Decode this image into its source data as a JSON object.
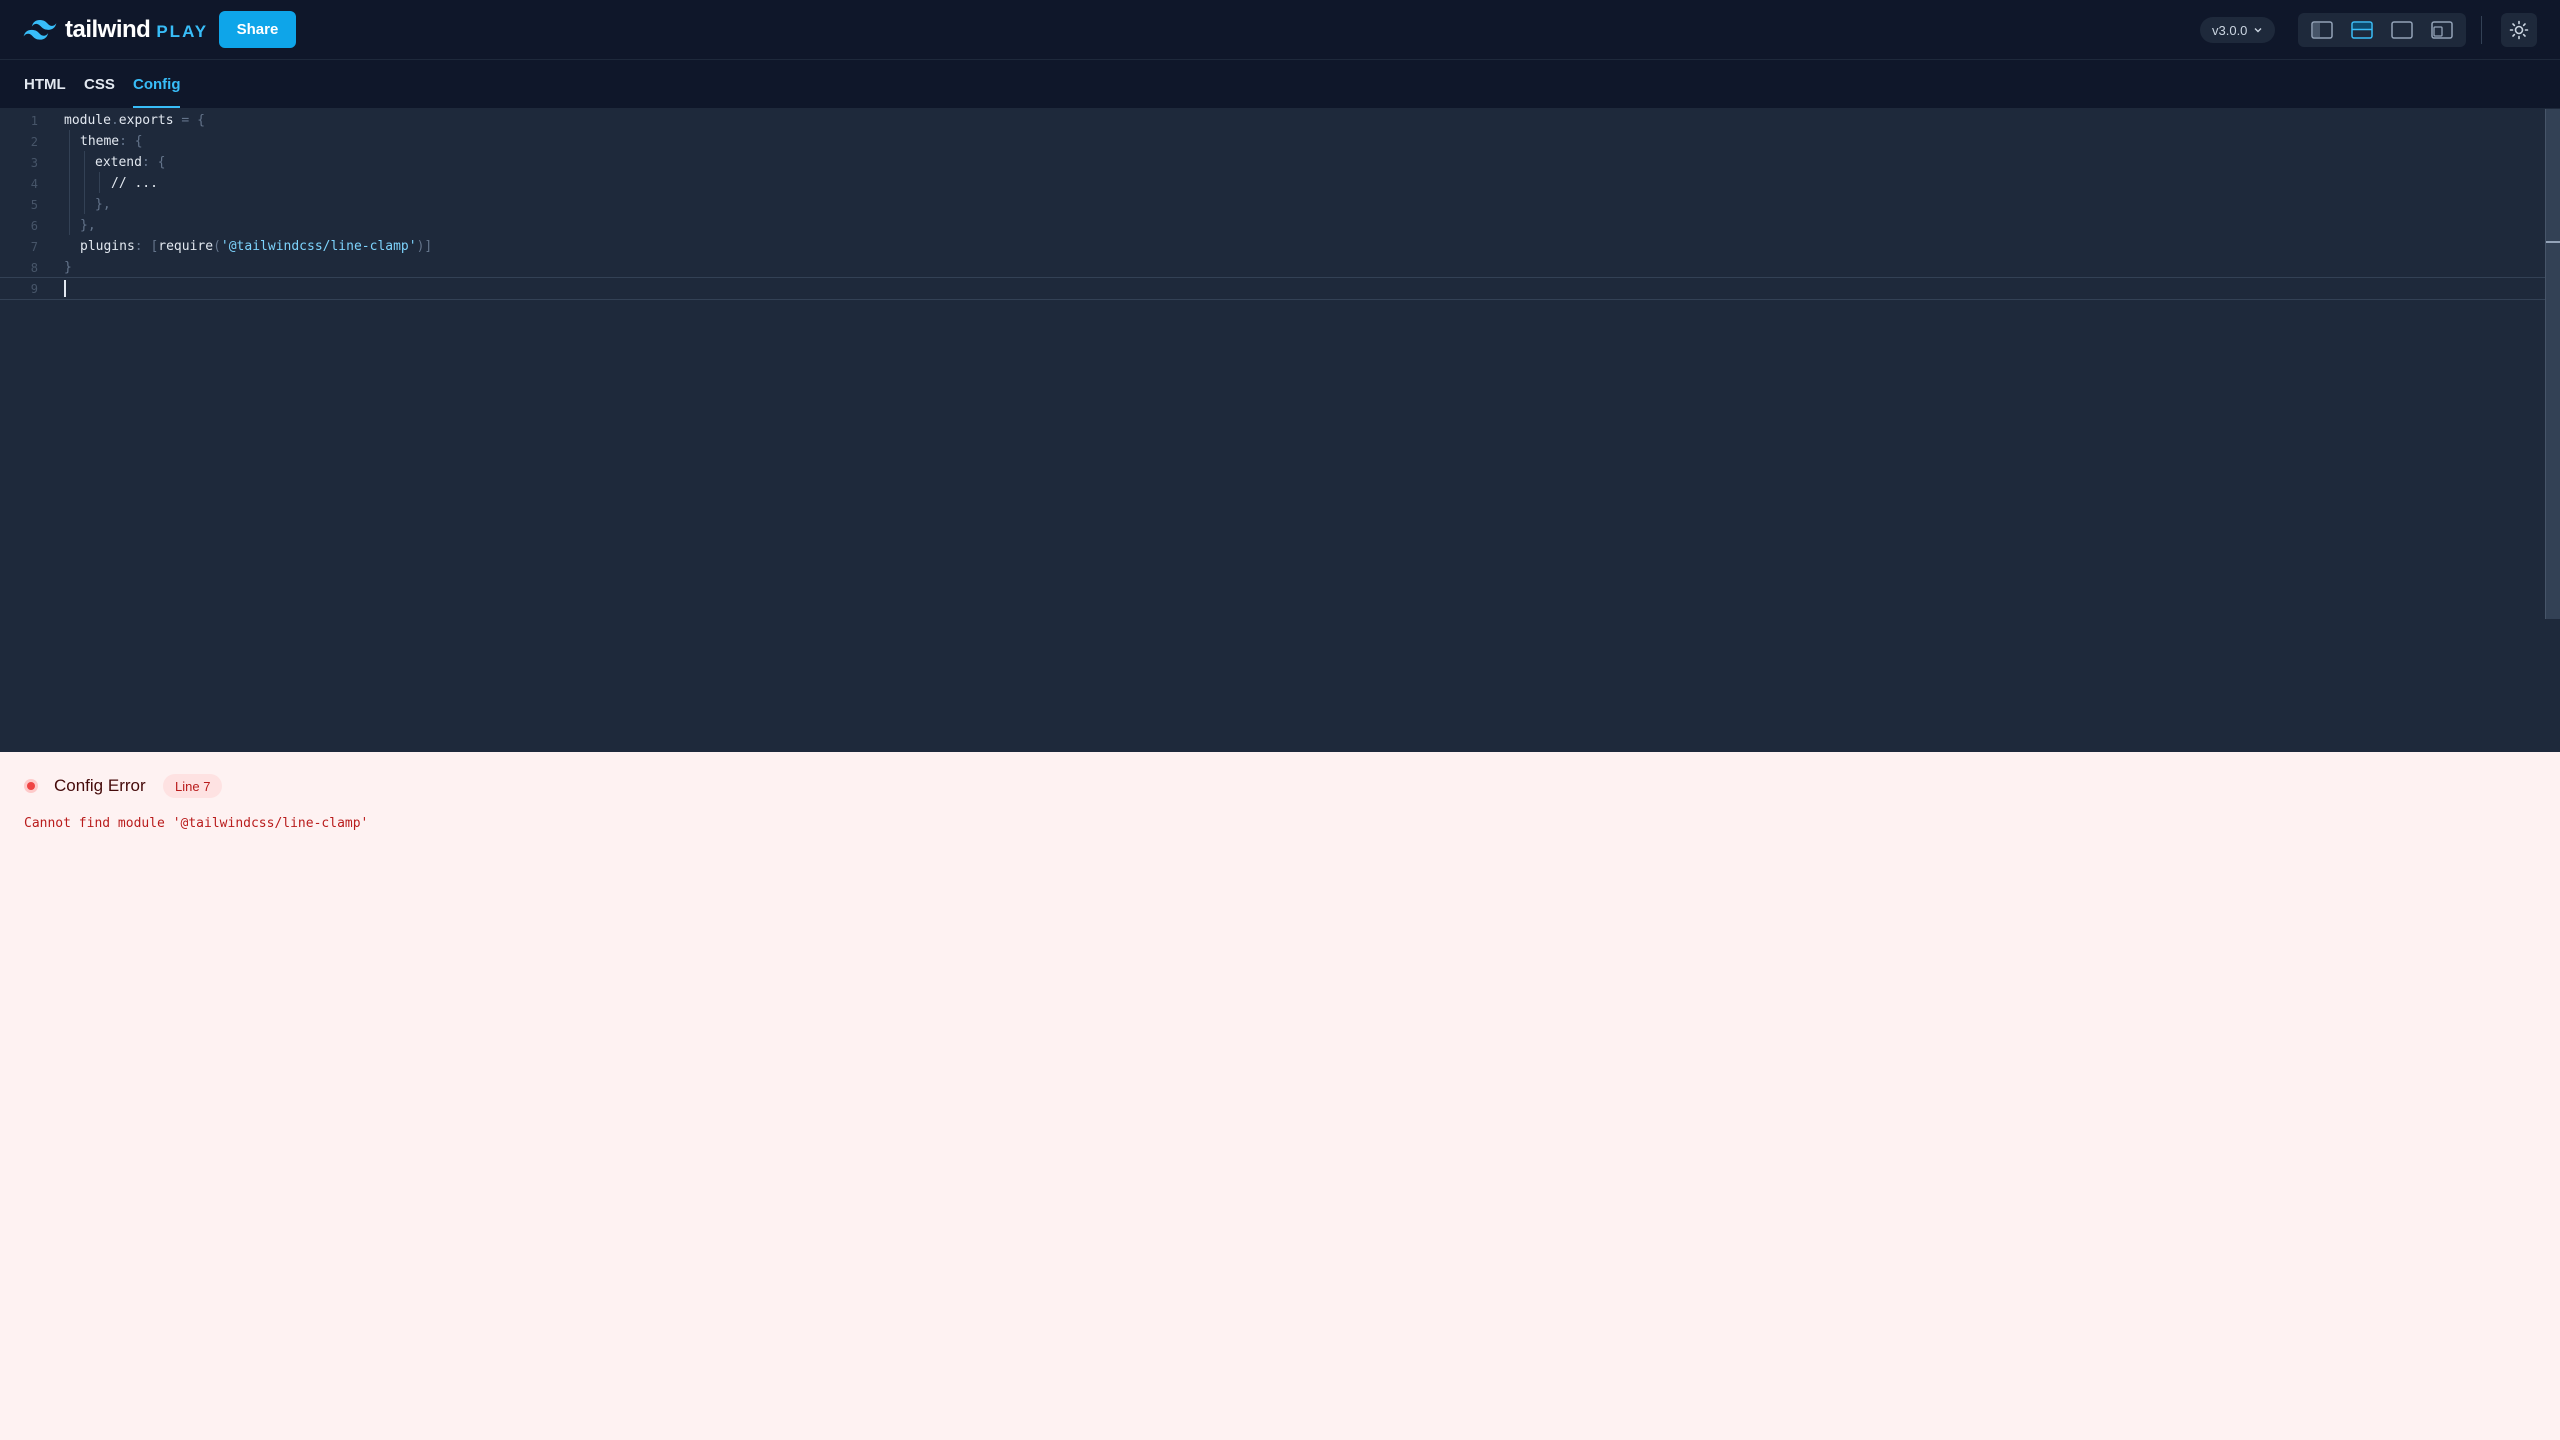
{
  "brand": {
    "name": "tailwind",
    "suffix": "PLAY"
  },
  "header": {
    "share_label": "Share",
    "version": "v3.0.0",
    "layout_buttons": [
      "layout-vertical-icon",
      "layout-horizontal-icon",
      "layout-preview-only-icon",
      "layout-responsive-icon"
    ],
    "active_layout_index": 1
  },
  "tabs": [
    {
      "label": "HTML",
      "active": false
    },
    {
      "label": "CSS",
      "active": false
    },
    {
      "label": "Config",
      "active": true
    }
  ],
  "editor": {
    "line_numbers": [
      "1",
      "2",
      "3",
      "4",
      "5",
      "6",
      "7",
      "8",
      "9"
    ],
    "lines": [
      {
        "text": "module",
        "dot": ".",
        "text2": "exports",
        "rest": " = {"
      },
      {
        "text": "theme",
        "rest": ": {"
      },
      {
        "text": "extend",
        "rest": ": {"
      },
      {
        "text": "// ..."
      },
      {
        "text": "},"
      },
      {
        "text": "},"
      },
      {
        "text": "plugins",
        "rest1": ": [",
        "fn": "require",
        "rest2": "(",
        "str": "'@tailwindcss/line-clamp'",
        "rest3": ")]"
      },
      {
        "text": "}"
      },
      {
        "text": ""
      }
    ]
  },
  "error": {
    "title": "Config Error",
    "badge": "Line 7",
    "message": "Cannot find module '@tailwindcss/line-clamp'"
  },
  "colors": {
    "accent": "#38bdf8",
    "share": "#0ea5e9",
    "error": "#ef4444",
    "editor_bg": "#1e293b",
    "error_bg": "#fef2f2"
  }
}
